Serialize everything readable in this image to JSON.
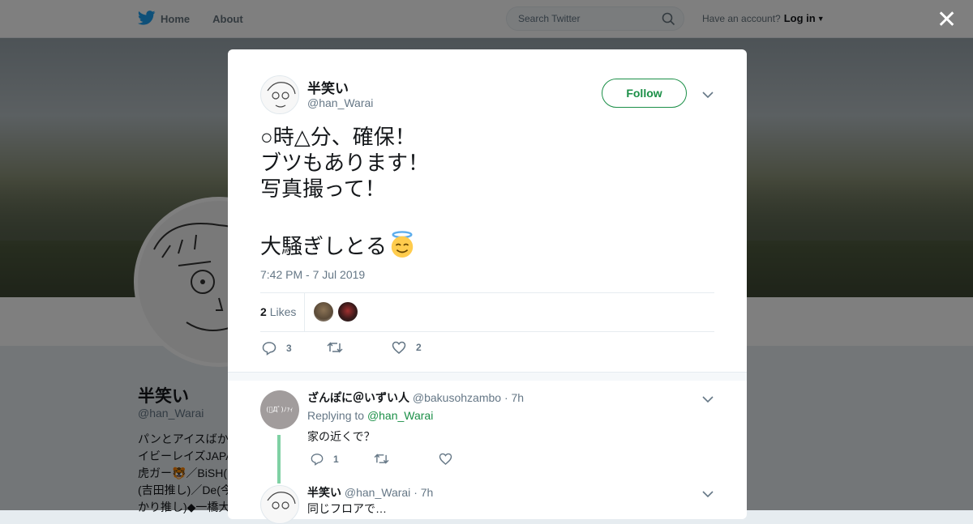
{
  "nav": {
    "home_label": "Home",
    "about_label": "About",
    "search_placeholder": "Search Twitter",
    "account_text": "Have an account?",
    "login_label": "Log in"
  },
  "background_profile": {
    "name": "半笑い",
    "handle": "@han_Warai",
    "bio_lines": [
      "パンとアイスばかり食べる",
      "イビーレイズJAPAN",
      "虎ガー🐯／BiSH(",
      "(吉田推し)／De(今",
      "かり推し)◆一橋大"
    ]
  },
  "tweet": {
    "author_name": "半笑い",
    "author_handle": "@han_Warai",
    "follow_label": "Follow",
    "text_lines": [
      "○時△分、確保！",
      "ブツもあります！",
      "写真撮って！",
      "",
      "大騒ぎしとる"
    ],
    "emoji": "smiling-face-with-halo",
    "timestamp": "7:42 PM - 7 Jul 2019",
    "likes_count": "2",
    "likes_label": "Likes",
    "reply_count": "3",
    "retweet_count": "",
    "like_count": "2"
  },
  "replies": [
    {
      "author_name": "ざんぽに＠いずい人",
      "author_handle": "@bakusohzambo",
      "time": "· 7h",
      "replying_prefix": "Replying to",
      "replying_to": "@han_Warai",
      "text": "家の近くで？",
      "reply_count": "1",
      "avatar_text": "(ﾟДﾟ)ﾉｧｨ"
    },
    {
      "author_name": "半笑い",
      "author_handle": "@han_Warai",
      "time": "· 7h",
      "text": "同じフロアで…"
    }
  ],
  "colors": {
    "accent_green": "#1b8f47",
    "twitter_blue": "#1da1f2",
    "muted_text": "#657786",
    "thread_line": "#7fd1a4"
  }
}
